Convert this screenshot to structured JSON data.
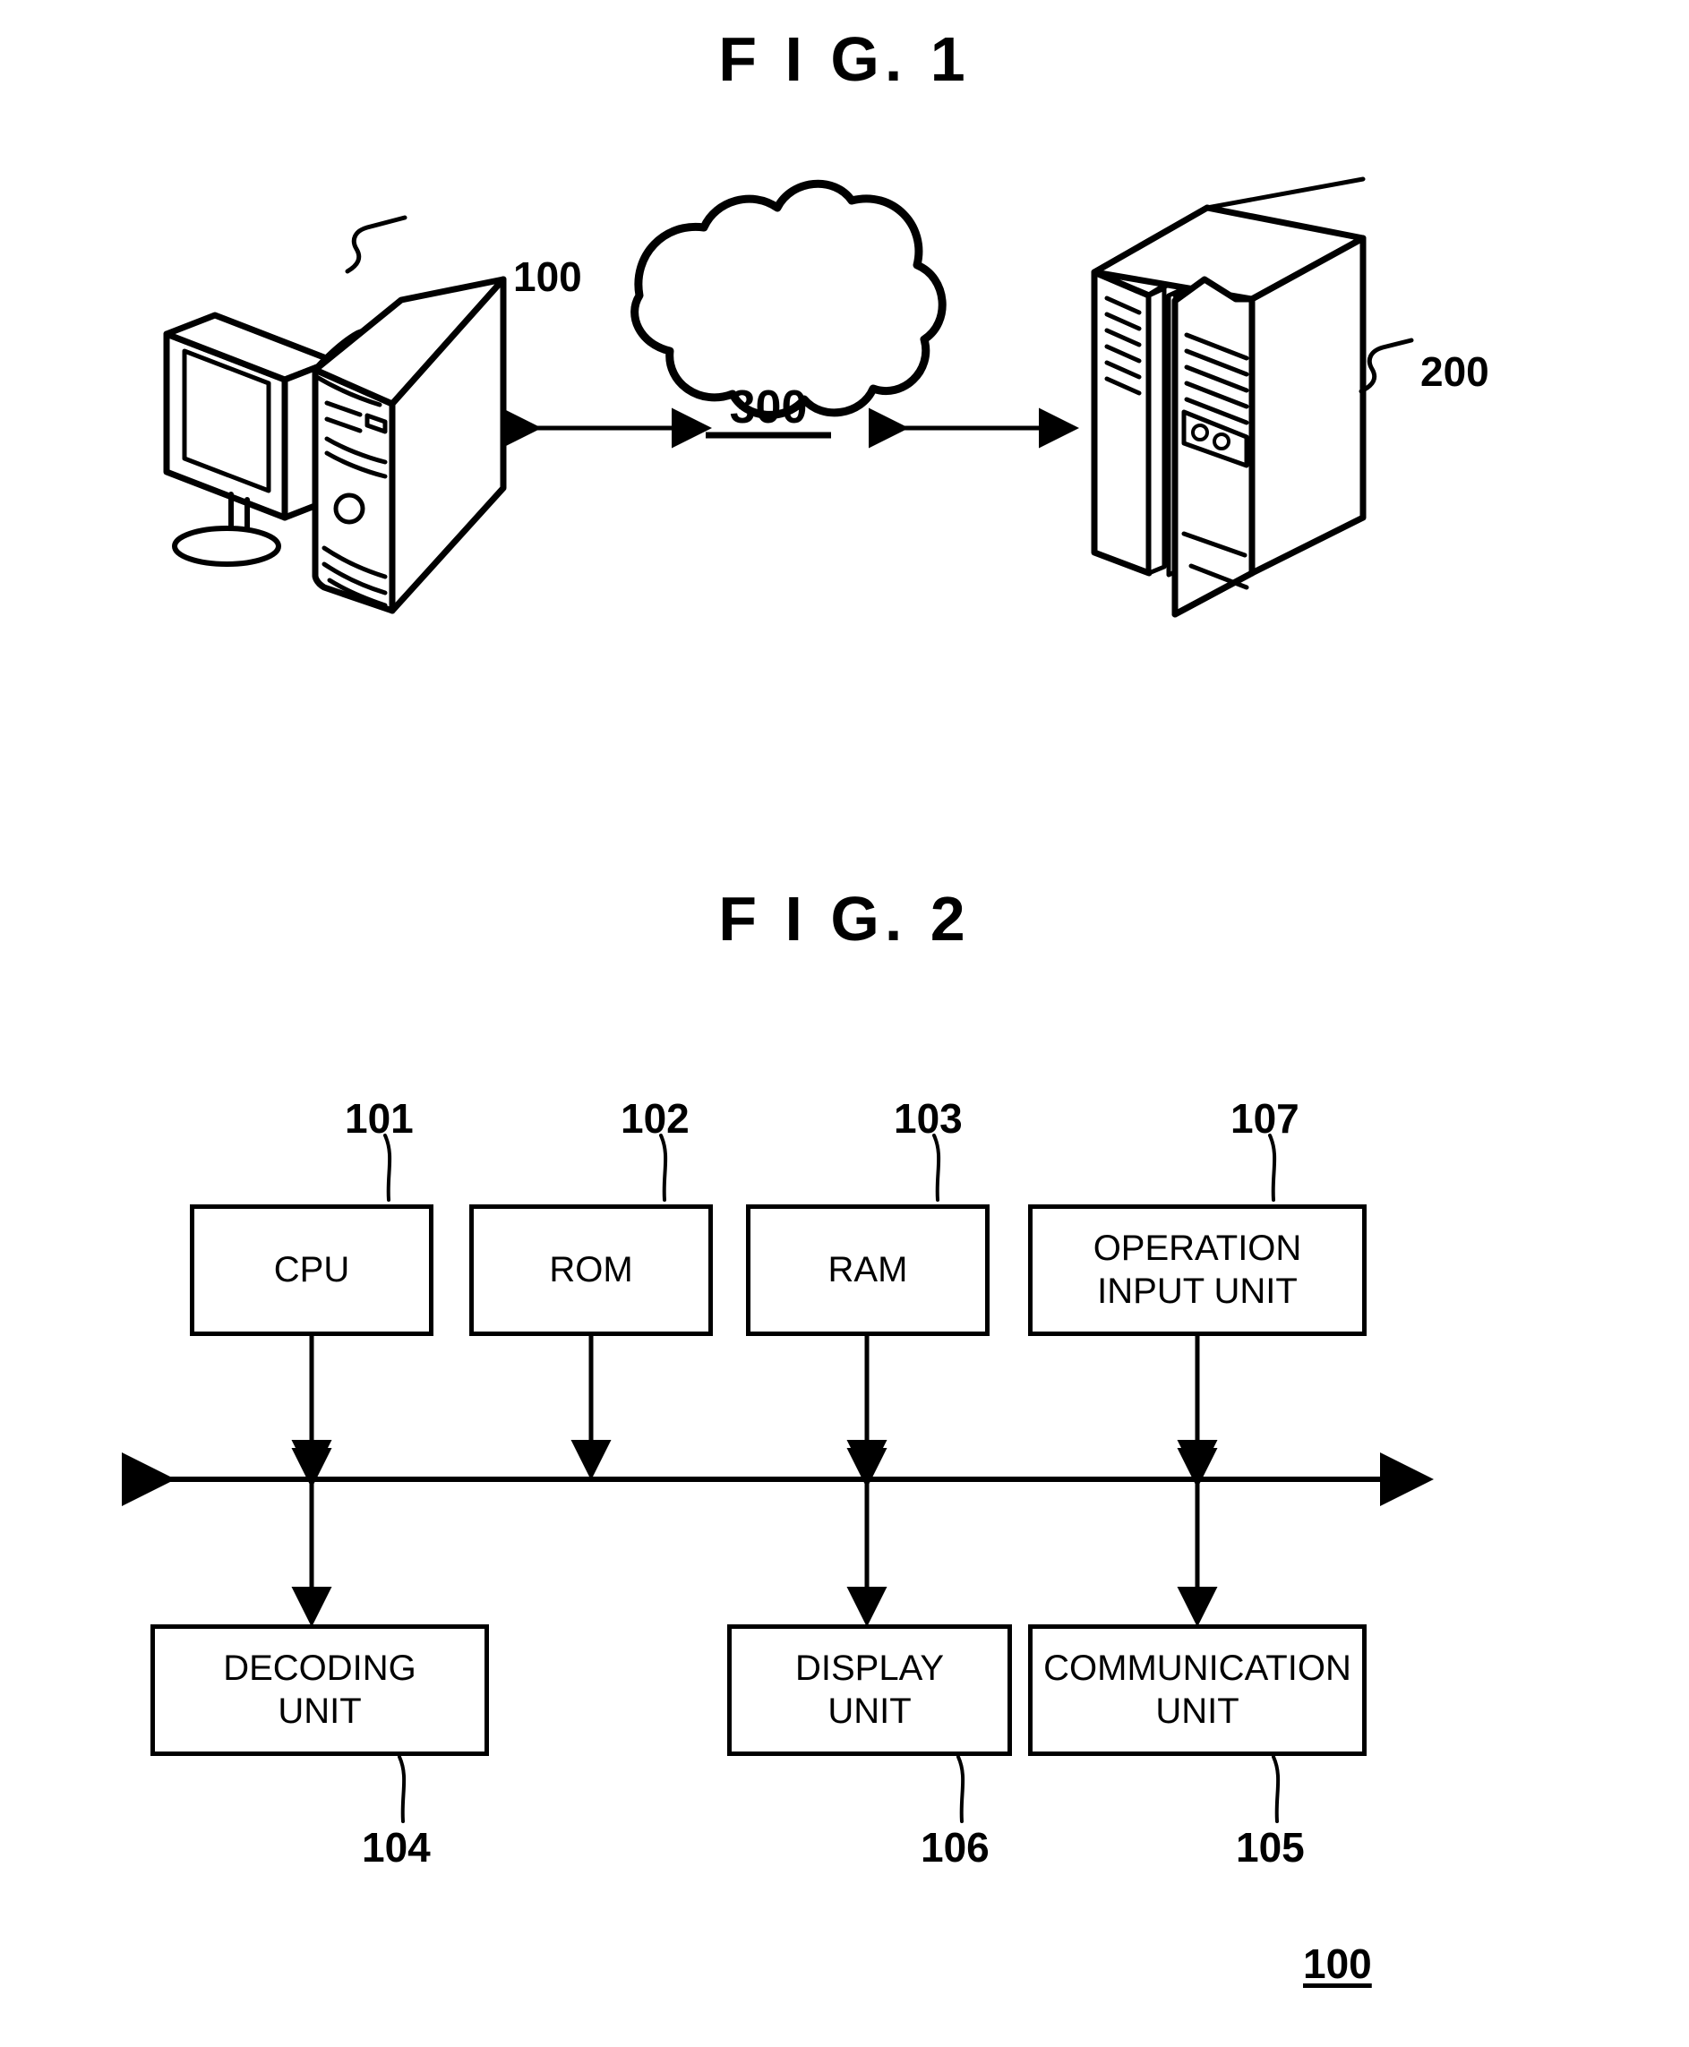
{
  "figures": [
    {
      "title": "F I G.  1",
      "labels": {
        "client": "100",
        "network": "300",
        "server": "200"
      },
      "nodes": [
        {
          "name": "client-computer",
          "icon": "desktop-computer-icon",
          "ref": "100"
        },
        {
          "name": "network-cloud",
          "icon": "cloud-icon",
          "ref": "300"
        },
        {
          "name": "server",
          "icon": "server-rack-icon",
          "ref": "200"
        }
      ],
      "connections": [
        {
          "from": "client-computer",
          "to": "network-cloud",
          "arrow": "double"
        },
        {
          "from": "network-cloud",
          "to": "server",
          "arrow": "double"
        }
      ]
    },
    {
      "title": "F I G.  2",
      "system_ref": "100",
      "top_blocks": [
        {
          "ref": "101",
          "label": "CPU",
          "arrow": "double"
        },
        {
          "ref": "102",
          "label": "ROM",
          "arrow": "double"
        },
        {
          "ref": "103",
          "label": "RAM",
          "arrow": "double"
        },
        {
          "ref": "107",
          "label": "OPERATION\nINPUT UNIT",
          "arrow": "down"
        }
      ],
      "bottom_blocks": [
        {
          "ref": "104",
          "label": "DECODING\nUNIT",
          "arrow": "double"
        },
        {
          "ref": "106",
          "label": "DISPLAY\nUNIT",
          "arrow": "double"
        },
        {
          "ref": "105",
          "label": "COMMUNICATION\nUNIT",
          "arrow": "double"
        }
      ],
      "bus": {
        "name": "system-bus",
        "arrow": "double-horizontal"
      }
    }
  ]
}
